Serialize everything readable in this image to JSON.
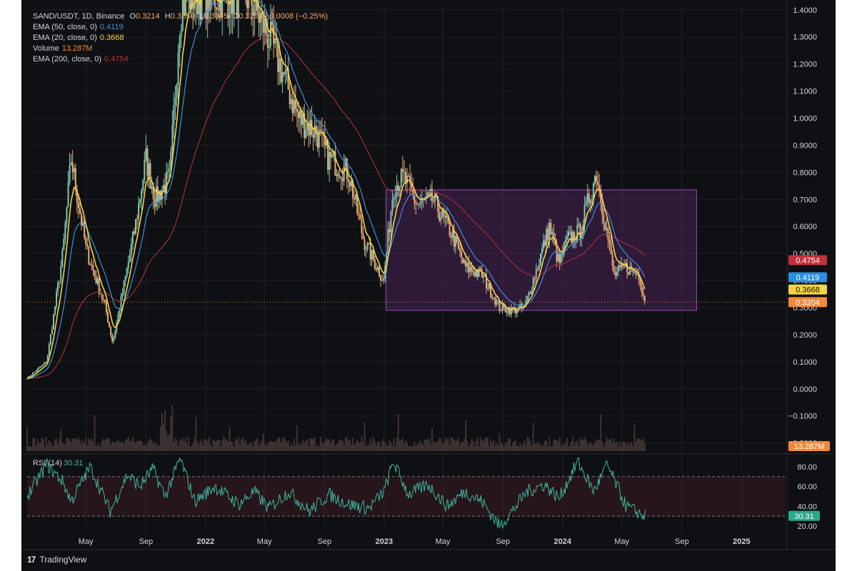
{
  "legend": {
    "title": "SAND/USDT, 1D, Binance",
    "ohlc": {
      "o_label": "O",
      "o": "0.3214",
      "h_label": "H",
      "h": "0.3250",
      "l_label": "L",
      "l": "0.3045",
      "c_label": "C",
      "c": "0.3204",
      "change": "−0.0008 (−0.25%)"
    },
    "ema50": {
      "label": "EMA (50, close, 0)",
      "value": "0.4119"
    },
    "ema20": {
      "label": "EMA (20, close, 0)",
      "value": "0.3668"
    },
    "volume": {
      "label": "Volume",
      "value": "13.287M"
    },
    "ema200": {
      "label": "EMA (200, close, 0)",
      "value": "0.4754"
    }
  },
  "rsi_legend": {
    "label": "RSI (14)",
    "value": "30.31"
  },
  "brand": {
    "name": "TradingView",
    "logo": "17"
  },
  "colors": {
    "background": "#0f1013",
    "grid": "#1d2027",
    "candle_up": "#7fc8b3",
    "candle_down": "#e8a979",
    "ema20": "#f5d342",
    "ema50": "#3b8fdc",
    "ema200": "#9c2f38",
    "rsi": "#3fb59d",
    "range_box": "#6b2a7c",
    "volume": "#4a3b3b"
  },
  "chart_data": [
    {
      "type": "candlestick",
      "title": "SAND/USDT, 1D, Binance",
      "y_ticks": [
        "1.4000",
        "1.3000",
        "1.2000",
        "1.1000",
        "1.0000",
        "0.9000",
        "0.8000",
        "0.7000",
        "0.6000",
        "0.5000",
        "0.4000",
        "0.3000",
        "0.2000",
        "0.1000",
        "0.0000",
        "−0.1000",
        "−0.2000"
      ],
      "ylim": [
        -0.23,
        1.41
      ],
      "x_ticks": [
        "May",
        "Sep",
        "2022",
        "May",
        "Sep",
        "2023",
        "May",
        "Sep",
        "2024",
        "May",
        "Sep",
        "2025"
      ],
      "price_series": {
        "name": "SAND/USDT close (approx.)",
        "x": [
          "2021-01-01",
          "2021-02-10",
          "2021-03-15",
          "2021-04-01",
          "2021-05-01",
          "2021-06-10",
          "2021-06-25",
          "2021-07-20",
          "2021-08-10",
          "2021-09-01",
          "2021-09-20",
          "2021-10-20",
          "2021-11-10",
          "2021-11-25",
          "2022-04-01",
          "2022-05-10",
          "2022-06-01",
          "2022-07-10",
          "2022-08-15",
          "2022-09-10",
          "2022-10-20",
          "2022-11-20",
          "2022-12-31",
          "2023-01-20",
          "2023-02-10",
          "2023-03-10",
          "2023-04-10",
          "2023-05-20",
          "2023-06-15",
          "2023-07-20",
          "2023-08-25",
          "2023-09-20",
          "2023-10-15",
          "2023-11-10",
          "2023-12-05",
          "2023-12-25",
          "2024-01-10",
          "2024-02-05",
          "2024-03-10",
          "2024-03-25",
          "2024-04-15",
          "2024-05-10",
          "2024-06-05",
          "2024-06-18"
        ],
        "y": [
          0.04,
          0.1,
          0.5,
          0.85,
          0.52,
          0.3,
          0.17,
          0.4,
          0.6,
          0.85,
          0.7,
          0.78,
          1.4,
          1.45,
          1.45,
          1.3,
          1.2,
          1.0,
          0.95,
          0.85,
          0.8,
          0.55,
          0.4,
          0.75,
          0.78,
          0.68,
          0.7,
          0.57,
          0.45,
          0.42,
          0.3,
          0.29,
          0.3,
          0.45,
          0.6,
          0.46,
          0.55,
          0.58,
          0.8,
          0.65,
          0.42,
          0.45,
          0.42,
          0.32
        ]
      },
      "emas": [
        {
          "name": "EMA (20, close, 0)",
          "value": "0.3668"
        },
        {
          "name": "EMA (50, close, 0)",
          "value": "0.4119"
        },
        {
          "name": "EMA (200, close, 0)",
          "value": "0.4754"
        }
      ],
      "last_values": [
        {
          "label": "0.4754",
          "color": "#c4303b",
          "y": 0.4754
        },
        {
          "label": "0.4119",
          "color": "#2d8ee0",
          "y": 0.4119
        },
        {
          "label": "0.3668",
          "color": "#f5d342",
          "y": 0.3668
        },
        {
          "label": "0.3204",
          "color": "#f08a3a",
          "y": 0.3204
        }
      ],
      "volume_label": "13.287M",
      "range_box": {
        "start": "2023-01-05",
        "end": "2024-10-01",
        "top": 0.735,
        "bottom": 0.29
      },
      "hline": 0.3204
    },
    {
      "type": "line",
      "title": "RSI (14)",
      "y_ticks": [
        "80.00",
        "60.00",
        "40.00",
        "20.00"
      ],
      "ylim": [
        15,
        90
      ],
      "upper_band": 70,
      "lower_band": 30,
      "last_value": "30.31",
      "series": {
        "name": "RSI (14)",
        "x": [
          "2021-01-01",
          "2021-02-10",
          "2021-03-15",
          "2021-04-01",
          "2021-05-10",
          "2021-06-20",
          "2021-07-25",
          "2021-08-20",
          "2021-09-15",
          "2021-10-10",
          "2021-11-10",
          "2021-12-10",
          "2022-01-20",
          "2022-03-10",
          "2022-04-10",
          "2022-05-10",
          "2022-06-20",
          "2022-08-01",
          "2022-09-10",
          "2022-10-20",
          "2022-12-01",
          "2023-01-01",
          "2023-01-20",
          "2023-02-20",
          "2023-04-01",
          "2023-05-10",
          "2023-06-15",
          "2023-07-20",
          "2023-08-25",
          "2023-09-20",
          "2023-10-20",
          "2023-11-25",
          "2023-12-25",
          "2024-02-01",
          "2024-03-05",
          "2024-04-01",
          "2024-05-10",
          "2024-06-18"
        ],
        "y": [
          50,
          82,
          65,
          45,
          80,
          35,
          72,
          60,
          78,
          50,
          88,
          45,
          60,
          42,
          55,
          38,
          55,
          35,
          52,
          42,
          38,
          55,
          85,
          52,
          62,
          40,
          55,
          45,
          20,
          35,
          55,
          62,
          48,
          85,
          55,
          82,
          40,
          30
        ]
      }
    }
  ]
}
